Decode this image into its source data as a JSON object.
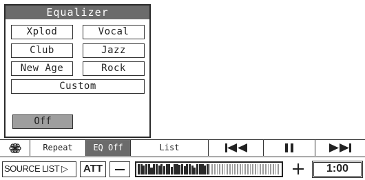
{
  "equalizer": {
    "title": "Equalizer",
    "presets": [
      "Xplod",
      "Vocal",
      "Club",
      "Jazz",
      "New Age",
      "Rock"
    ],
    "custom": "Custom",
    "off": "Off",
    "selected": "Off"
  },
  "controls": {
    "flower_icon": "flower-icon",
    "repeat": "Repeat",
    "eq_off": "EQ Off",
    "list": "List",
    "prev_icon": "skip-back-icon",
    "pause_icon": "pause-icon",
    "next_icon": "skip-forward-icon"
  },
  "status": {
    "source_list": "SOURCE LIST ▷",
    "att": "ATT",
    "volume_level": 0.5,
    "time": "1:00"
  },
  "colors": {
    "panel_header": "#6b6b6b",
    "active_bg": "#9e9e9e",
    "line": "#333333"
  }
}
